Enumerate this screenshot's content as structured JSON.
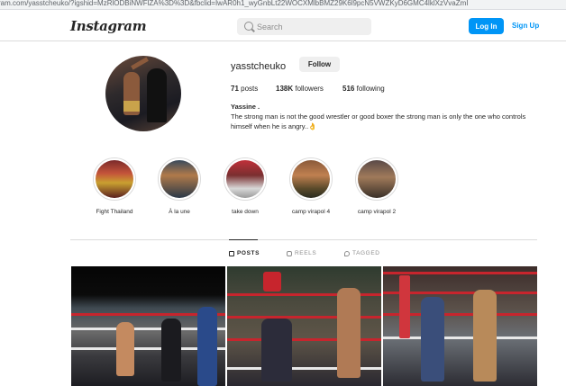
{
  "browser": {
    "url": "ram.com/yasstcheuko/?igshid=MzRlODBiNWFlZA%3D%3D&fbclid=IwAR0h1_wyGnbLt22WOCXMlbBMZ29K6l9pcN5VWZKyD6GMC4lklXzVvaZmI"
  },
  "nav": {
    "logo": "Instagram",
    "search_placeholder": "Search",
    "login_label": "Log In",
    "signup_label": "Sign Up"
  },
  "profile": {
    "username": "yasstcheuko",
    "follow_label": "Follow",
    "posts_count": "71",
    "posts_label": "posts",
    "followers_count": "138K",
    "followers_label": "followers",
    "following_count": "516",
    "following_label": "following",
    "full_name": "Yassine .",
    "bio": "The strong man is not the good wrestler or good boxer the strong man is only the one who controls himself when he is angry..👌"
  },
  "highlights": [
    {
      "label": "Fight Thailand"
    },
    {
      "label": "À la une"
    },
    {
      "label": "take down"
    },
    {
      "label": "camp virapol 4"
    },
    {
      "label": "camp virapol 2"
    }
  ],
  "tabs": [
    {
      "label": "POSTS",
      "icon": "grid-icon",
      "active": true
    },
    {
      "label": "REELS",
      "icon": "reels-icon",
      "active": false
    },
    {
      "label": "TAGGED",
      "icon": "tag-icon",
      "active": false
    }
  ],
  "posts": [
    {
      "description": "muay thai ring fight"
    },
    {
      "description": "fighter in ring corner"
    },
    {
      "description": "fighters exchanging in ring"
    }
  ],
  "colors": {
    "accent": "#0095f6",
    "text": "#262626",
    "secondary_text": "#8e8e8e",
    "border": "#dbdbdb"
  }
}
